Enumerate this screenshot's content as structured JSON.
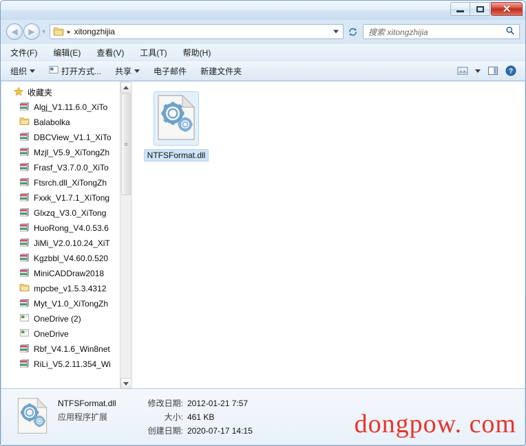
{
  "window": {
    "controls": {
      "minimize_label": "–",
      "maximize_label": "□",
      "close_label": "✕"
    }
  },
  "address": {
    "folder_icon": "folder-icon",
    "separator": "▸",
    "path_text": "xitongzhijia",
    "dropdown_icon": "chevron-down-icon",
    "refresh_icon": "refresh-icon"
  },
  "search": {
    "placeholder": "搜索 xitongzhijia",
    "icon": "search-icon"
  },
  "menu": {
    "items": [
      {
        "label": "文件(F)",
        "name": "menu-file"
      },
      {
        "label": "编辑(E)",
        "name": "menu-edit"
      },
      {
        "label": "查看(V)",
        "name": "menu-view"
      },
      {
        "label": "工具(T)",
        "name": "menu-tools"
      },
      {
        "label": "帮助(H)",
        "name": "menu-help"
      }
    ]
  },
  "commandbar": {
    "organize": "组织",
    "open_with": "打开方式...",
    "share": "共享",
    "email": "电子邮件",
    "new_folder": "新建文件夹",
    "view_icon": "view-layout-icon",
    "preview_icon": "preview-pane-icon",
    "help_icon": "help-icon"
  },
  "sidebar": {
    "header": {
      "label": "收藏夹",
      "icon": "star-icon"
    },
    "items": [
      {
        "label": "Algj_V1.11.6.0_XiTo",
        "icon": "archive-icon"
      },
      {
        "label": "Balabolka",
        "icon": "folder-icon"
      },
      {
        "label": "DBCView_V1.1_XiTo",
        "icon": "archive-icon"
      },
      {
        "label": "Mzjl_V5.9_XiTongZh",
        "icon": "archive-icon"
      },
      {
        "label": "Frasf_V3.7.0.0_XiTo",
        "icon": "archive-icon"
      },
      {
        "label": "Ftsrch.dll_XiTongZh",
        "icon": "archive-icon"
      },
      {
        "label": "Fxxk_V1.7.1_XiTong",
        "icon": "archive-icon"
      },
      {
        "label": "Glxzq_V3.0_XiTong",
        "icon": "archive-icon"
      },
      {
        "label": "HuoRong_V4.0.53.6",
        "icon": "archive-icon"
      },
      {
        "label": "JiMi_V2.0.10.24_XiT",
        "icon": "archive-icon"
      },
      {
        "label": "Kgzbbl_V4.60.0.520",
        "icon": "archive-icon"
      },
      {
        "label": "MiniCADDraw2018",
        "icon": "archive-icon"
      },
      {
        "label": "mpcbe_v1.5.3.4312",
        "icon": "folder-icon"
      },
      {
        "label": "Myt_V1.0_XiTongZh",
        "icon": "archive-icon"
      },
      {
        "label": "OneDrive (2)",
        "icon": "shortcut-icon"
      },
      {
        "label": "OneDrive",
        "icon": "shortcut-icon"
      },
      {
        "label": "Rbf_V4.1.6_Win8net",
        "icon": "archive-icon"
      },
      {
        "label": "RiLi_V5.2.11.354_Wi",
        "icon": "archive-icon"
      }
    ],
    "scrollbar": {
      "up_icon": "scroll-up-icon",
      "down_icon": "scroll-down-icon",
      "thumb_grip": "≡"
    }
  },
  "files": [
    {
      "name": "NTFSFormat.dll",
      "icon": "dll-file-icon",
      "selected": true
    }
  ],
  "details": {
    "file_name": "NTFSFormat.dll",
    "file_type": "应用程序扩展",
    "modified_key": "修改日期:",
    "modified_value": "2012-01-21 7:57",
    "size_key": "大小:",
    "size_value": "461 KB",
    "created_key": "创建日期:",
    "created_value": "2020-07-17 14:15",
    "icon": "dll-file-icon"
  },
  "watermark": {
    "text": "dongpow. com",
    "color": "#e8342b"
  }
}
